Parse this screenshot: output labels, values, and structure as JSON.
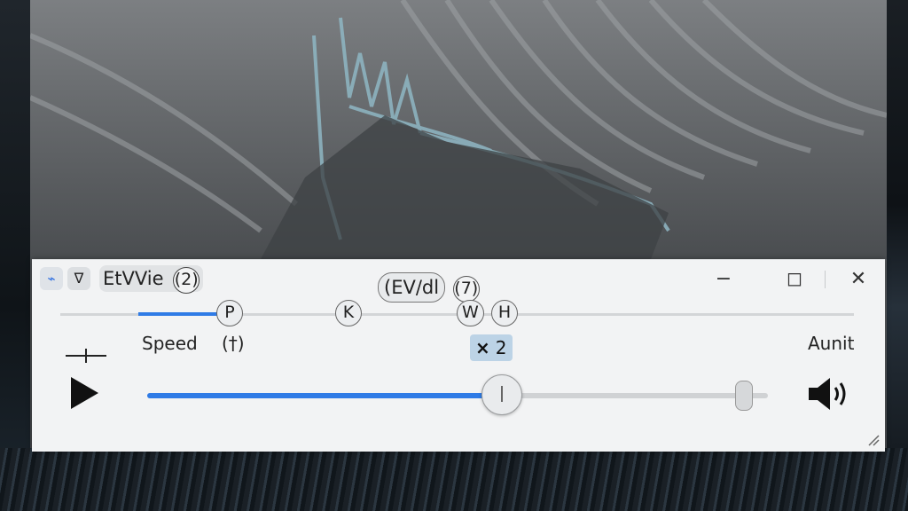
{
  "window": {
    "title": "EtVVie",
    "title_count": "(2)",
    "center_title": "(EV/dl",
    "center_count": "(7)",
    "controls": {
      "minimize": "−",
      "restore": "◻",
      "close": "✕"
    }
  },
  "chapters": {
    "progress_fraction": 0.16,
    "markers": [
      {
        "label": "P"
      },
      {
        "label": "K"
      },
      {
        "label": "W"
      },
      {
        "label": "H"
      }
    ]
  },
  "speed": {
    "label": "Speed",
    "hint": "(†)",
    "multiplier_symbol": "×",
    "multiplier_value": "2",
    "left_icon": "minus-plus-icon"
  },
  "audio": {
    "label": "Aunit",
    "icon": "speaker-icon"
  },
  "playback": {
    "icon": "play-icon",
    "position_fraction": 0.57,
    "volume_fraction": 0.96
  },
  "colors": {
    "accent": "#2f7be6",
    "badge_bg": "#bcd3e6",
    "panel_bg": "#f2f3f4"
  }
}
